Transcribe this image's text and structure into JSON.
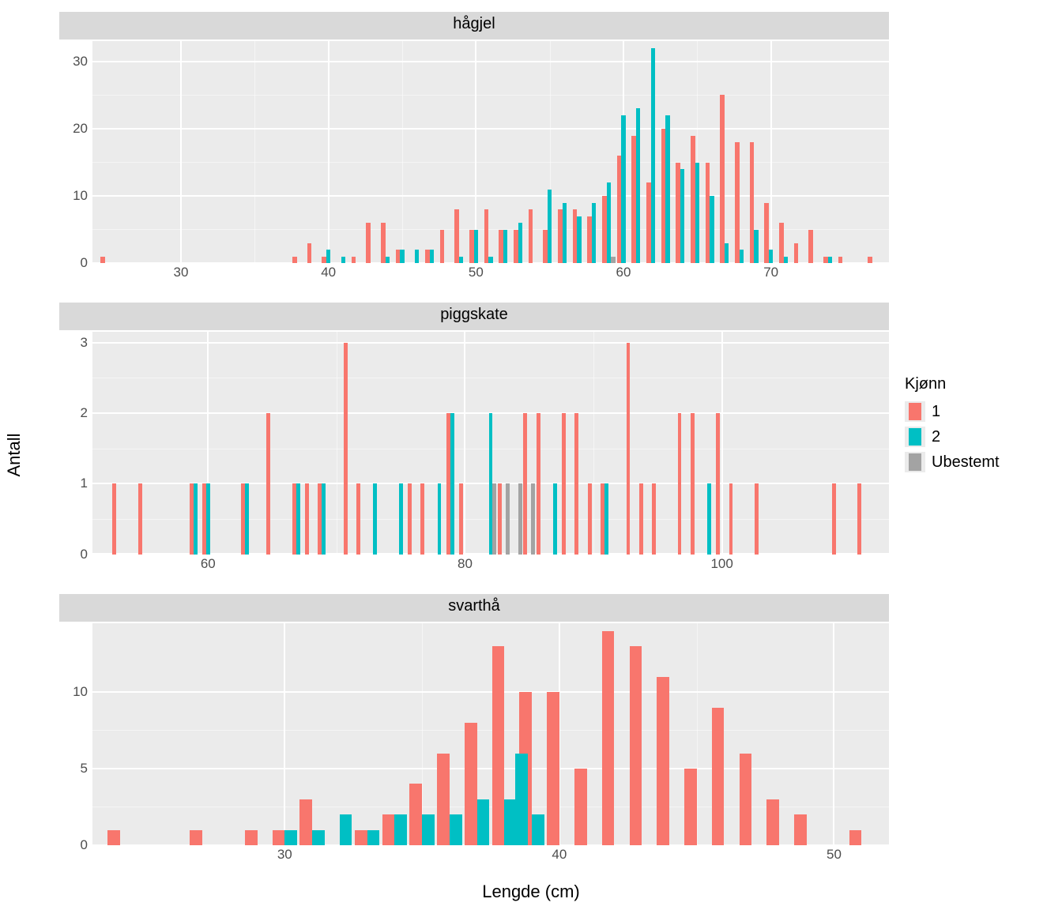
{
  "axis": {
    "x_title": "Lengde (cm)",
    "y_title": "Antall"
  },
  "legend": {
    "title": "Kjønn",
    "items": [
      {
        "label": "1",
        "color": "#F8766D"
      },
      {
        "label": "2",
        "color": "#00BFC4"
      },
      {
        "label": "Ubestemt",
        "color": "#A3A3A3"
      }
    ]
  },
  "chart_data": [
    {
      "facet": "hågjel",
      "type": "bar",
      "x_range": [
        24,
        78
      ],
      "y_range": [
        0,
        33
      ],
      "y_ticks": [
        0,
        10,
        20,
        30
      ],
      "x_ticks": [
        30,
        40,
        50,
        60,
        70
      ],
      "series": [
        {
          "name": "1",
          "color": "#F8766D",
          "points": [
            {
              "x": 25,
              "y": 1
            },
            {
              "x": 38,
              "y": 1
            },
            {
              "x": 39,
              "y": 3
            },
            {
              "x": 40,
              "y": 1
            },
            {
              "x": 42,
              "y": 1
            },
            {
              "x": 43,
              "y": 6
            },
            {
              "x": 44,
              "y": 6
            },
            {
              "x": 45,
              "y": 2
            },
            {
              "x": 47,
              "y": 2
            },
            {
              "x": 48,
              "y": 5
            },
            {
              "x": 49,
              "y": 8
            },
            {
              "x": 50,
              "y": 5
            },
            {
              "x": 51,
              "y": 8
            },
            {
              "x": 52,
              "y": 5
            },
            {
              "x": 53,
              "y": 5
            },
            {
              "x": 54,
              "y": 8
            },
            {
              "x": 55,
              "y": 5
            },
            {
              "x": 56,
              "y": 8
            },
            {
              "x": 57,
              "y": 8
            },
            {
              "x": 58,
              "y": 7
            },
            {
              "x": 59,
              "y": 10
            },
            {
              "x": 60,
              "y": 16
            },
            {
              "x": 61,
              "y": 19
            },
            {
              "x": 62,
              "y": 12
            },
            {
              "x": 63,
              "y": 20
            },
            {
              "x": 64,
              "y": 15
            },
            {
              "x": 65,
              "y": 19
            },
            {
              "x": 66,
              "y": 15
            },
            {
              "x": 67,
              "y": 25
            },
            {
              "x": 68,
              "y": 18
            },
            {
              "x": 69,
              "y": 18
            },
            {
              "x": 70,
              "y": 9
            },
            {
              "x": 71,
              "y": 6
            },
            {
              "x": 72,
              "y": 3
            },
            {
              "x": 73,
              "y": 5
            },
            {
              "x": 74,
              "y": 1
            },
            {
              "x": 75,
              "y": 1
            },
            {
              "x": 77,
              "y": 1
            }
          ]
        },
        {
          "name": "2",
          "color": "#00BFC4",
          "points": [
            {
              "x": 40,
              "y": 2
            },
            {
              "x": 41,
              "y": 1
            },
            {
              "x": 44,
              "y": 1
            },
            {
              "x": 45,
              "y": 2
            },
            {
              "x": 46,
              "y": 2
            },
            {
              "x": 47,
              "y": 2
            },
            {
              "x": 49,
              "y": 1
            },
            {
              "x": 50,
              "y": 5
            },
            {
              "x": 51,
              "y": 1
            },
            {
              "x": 52,
              "y": 5
            },
            {
              "x": 53,
              "y": 6
            },
            {
              "x": 55,
              "y": 11
            },
            {
              "x": 56,
              "y": 9
            },
            {
              "x": 57,
              "y": 7
            },
            {
              "x": 58,
              "y": 9
            },
            {
              "x": 59,
              "y": 12
            },
            {
              "x": 60,
              "y": 22
            },
            {
              "x": 61,
              "y": 23
            },
            {
              "x": 62,
              "y": 32
            },
            {
              "x": 63,
              "y": 22
            },
            {
              "x": 64,
              "y": 14
            },
            {
              "x": 65,
              "y": 15
            },
            {
              "x": 66,
              "y": 10
            },
            {
              "x": 67,
              "y": 3
            },
            {
              "x": 68,
              "y": 2
            },
            {
              "x": 69,
              "y": 5
            },
            {
              "x": 70,
              "y": 2
            },
            {
              "x": 71,
              "y": 1
            },
            {
              "x": 74,
              "y": 1
            }
          ]
        },
        {
          "name": "Ubestemt",
          "color": "#A3A3A3",
          "points": [
            {
              "x": 59,
              "y": 1
            }
          ]
        }
      ]
    },
    {
      "facet": "piggskate",
      "type": "bar",
      "x_range": [
        51,
        113
      ],
      "y_range": [
        0,
        3.15
      ],
      "y_ticks": [
        0,
        1,
        2,
        3
      ],
      "x_ticks": [
        60,
        80,
        100
      ],
      "series": [
        {
          "name": "1",
          "color": "#F8766D",
          "points": [
            {
              "x": 53,
              "y": 1
            },
            {
              "x": 55,
              "y": 1
            },
            {
              "x": 59,
              "y": 1
            },
            {
              "x": 60,
              "y": 1
            },
            {
              "x": 63,
              "y": 1
            },
            {
              "x": 65,
              "y": 2
            },
            {
              "x": 67,
              "y": 1
            },
            {
              "x": 68,
              "y": 1
            },
            {
              "x": 69,
              "y": 1
            },
            {
              "x": 71,
              "y": 3
            },
            {
              "x": 72,
              "y": 1
            },
            {
              "x": 76,
              "y": 1
            },
            {
              "x": 77,
              "y": 1
            },
            {
              "x": 79,
              "y": 2
            },
            {
              "x": 80,
              "y": 1
            },
            {
              "x": 83,
              "y": 1
            },
            {
              "x": 85,
              "y": 2
            },
            {
              "x": 86,
              "y": 2
            },
            {
              "x": 88,
              "y": 2
            },
            {
              "x": 89,
              "y": 2
            },
            {
              "x": 90,
              "y": 1
            },
            {
              "x": 91,
              "y": 1
            },
            {
              "x": 93,
              "y": 3
            },
            {
              "x": 94,
              "y": 1
            },
            {
              "x": 95,
              "y": 1
            },
            {
              "x": 97,
              "y": 2
            },
            {
              "x": 98,
              "y": 2
            },
            {
              "x": 100,
              "y": 2
            },
            {
              "x": 101,
              "y": 1
            },
            {
              "x": 103,
              "y": 1
            },
            {
              "x": 109,
              "y": 1
            },
            {
              "x": 111,
              "y": 1
            }
          ]
        },
        {
          "name": "2",
          "color": "#00BFC4",
          "points": [
            {
              "x": 59,
              "y": 1
            },
            {
              "x": 60,
              "y": 1
            },
            {
              "x": 63,
              "y": 1
            },
            {
              "x": 67,
              "y": 1
            },
            {
              "x": 69,
              "y": 1
            },
            {
              "x": 73,
              "y": 1
            },
            {
              "x": 75,
              "y": 1
            },
            {
              "x": 78,
              "y": 1
            },
            {
              "x": 79,
              "y": 2
            },
            {
              "x": 82,
              "y": 2
            },
            {
              "x": 87,
              "y": 1
            },
            {
              "x": 91,
              "y": 1
            },
            {
              "x": 99,
              "y": 1
            }
          ]
        },
        {
          "name": "Ubestemt",
          "color": "#A3A3A3",
          "points": [
            {
              "x": 82,
              "y": 1
            },
            {
              "x": 83,
              "y": 1
            },
            {
              "x": 84,
              "y": 1
            },
            {
              "x": 85,
              "y": 1
            }
          ]
        }
      ]
    },
    {
      "facet": "svarthå",
      "type": "bar",
      "x_range": [
        23,
        52
      ],
      "y_range": [
        0,
        14.5
      ],
      "y_ticks": [
        0,
        5,
        10
      ],
      "x_ticks": [
        30,
        40,
        50
      ],
      "series": [
        {
          "name": "1",
          "color": "#F8766D",
          "points": [
            {
              "x": 24,
              "y": 1
            },
            {
              "x": 27,
              "y": 1
            },
            {
              "x": 29,
              "y": 1
            },
            {
              "x": 30,
              "y": 1
            },
            {
              "x": 31,
              "y": 3
            },
            {
              "x": 33,
              "y": 1
            },
            {
              "x": 34,
              "y": 2
            },
            {
              "x": 35,
              "y": 4
            },
            {
              "x": 36,
              "y": 6
            },
            {
              "x": 37,
              "y": 8
            },
            {
              "x": 38,
              "y": 13
            },
            {
              "x": 39,
              "y": 10
            },
            {
              "x": 40,
              "y": 10
            },
            {
              "x": 41,
              "y": 5
            },
            {
              "x": 42,
              "y": 14
            },
            {
              "x": 43,
              "y": 13
            },
            {
              "x": 44,
              "y": 11
            },
            {
              "x": 45,
              "y": 5
            },
            {
              "x": 46,
              "y": 9
            },
            {
              "x": 47,
              "y": 6
            },
            {
              "x": 48,
              "y": 3
            },
            {
              "x": 49,
              "y": 2
            },
            {
              "x": 51,
              "y": 1
            }
          ]
        },
        {
          "name": "2",
          "color": "#00BFC4",
          "points": [
            {
              "x": 30,
              "y": 1
            },
            {
              "x": 31,
              "y": 1
            },
            {
              "x": 32,
              "y": 2
            },
            {
              "x": 33,
              "y": 1
            },
            {
              "x": 34,
              "y": 2
            },
            {
              "x": 35,
              "y": 2
            },
            {
              "x": 36,
              "y": 2
            },
            {
              "x": 37,
              "y": 3
            },
            {
              "x": 38,
              "y": 3
            },
            {
              "x": 38.4,
              "y": 6
            },
            {
              "x": 39,
              "y": 2
            }
          ]
        }
      ]
    }
  ]
}
